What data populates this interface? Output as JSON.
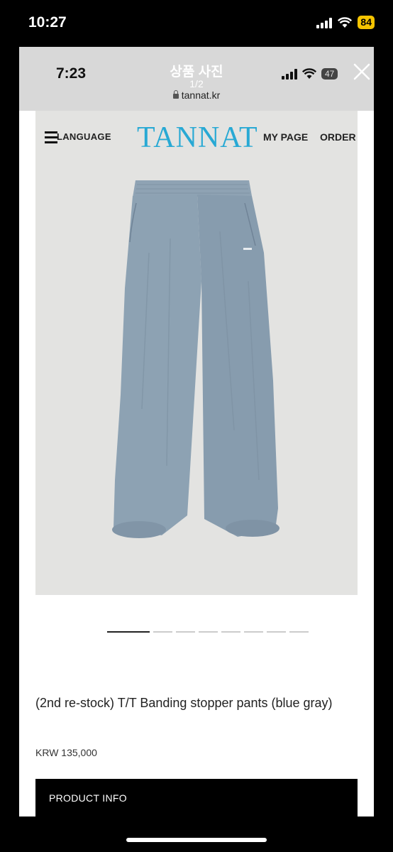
{
  "device": {
    "time": "10:27",
    "battery": "84"
  },
  "screenshot": {
    "time": "7:23",
    "battery": "47"
  },
  "viewer": {
    "title": "상품 사진",
    "counter": "1/2",
    "url": "tannat.kr"
  },
  "site": {
    "nav_language": "LANGUAGE",
    "logo": "TANNAT",
    "nav_mypage": "MY PAGE",
    "nav_order": "ORDER"
  },
  "slider": {
    "count": 8,
    "active_index": 0
  },
  "product": {
    "title": "(2nd re-stock) T/T Banding stopper pants (blue gray)",
    "price": "KRW 135,000",
    "info_label": "PRODUCT INFO"
  },
  "colors": {
    "logo": "#28a9d4",
    "pants": "#8da2b3",
    "battery_badge": "#f5c400"
  },
  "icons": [
    "signal-icon",
    "wifi-icon",
    "battery-icon",
    "close-icon",
    "lock-icon",
    "menu-icon"
  ]
}
